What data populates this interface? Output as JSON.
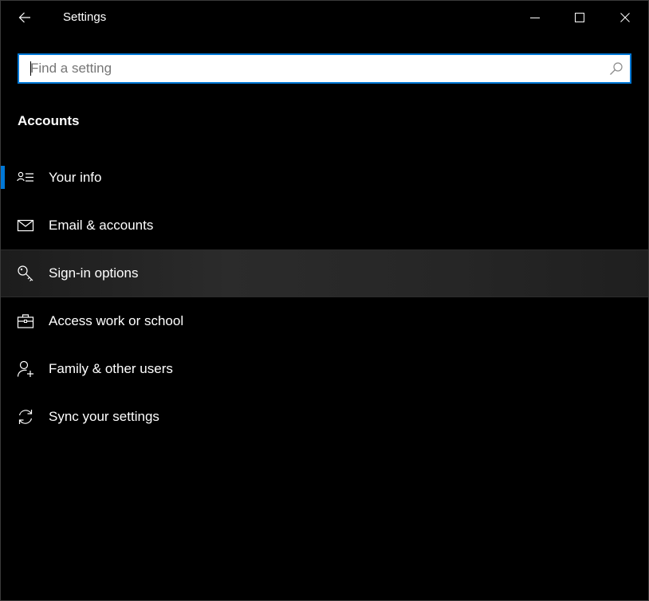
{
  "window": {
    "title": "Settings"
  },
  "search": {
    "placeholder": "Find a setting",
    "value": ""
  },
  "section": {
    "title": "Accounts"
  },
  "nav": {
    "items": [
      {
        "label": "Your info",
        "icon": "person-list-icon",
        "selected": true
      },
      {
        "label": "Email & accounts",
        "icon": "mail-icon"
      },
      {
        "label": "Sign-in options",
        "icon": "key-icon",
        "hovered": true
      },
      {
        "label": "Access work or school",
        "icon": "briefcase-icon"
      },
      {
        "label": "Family & other users",
        "icon": "add-person-icon"
      },
      {
        "label": "Sync your settings",
        "icon": "sync-icon"
      }
    ]
  },
  "colors": {
    "accent": "#0078d7",
    "background": "#000000",
    "text": "#ffffff"
  }
}
